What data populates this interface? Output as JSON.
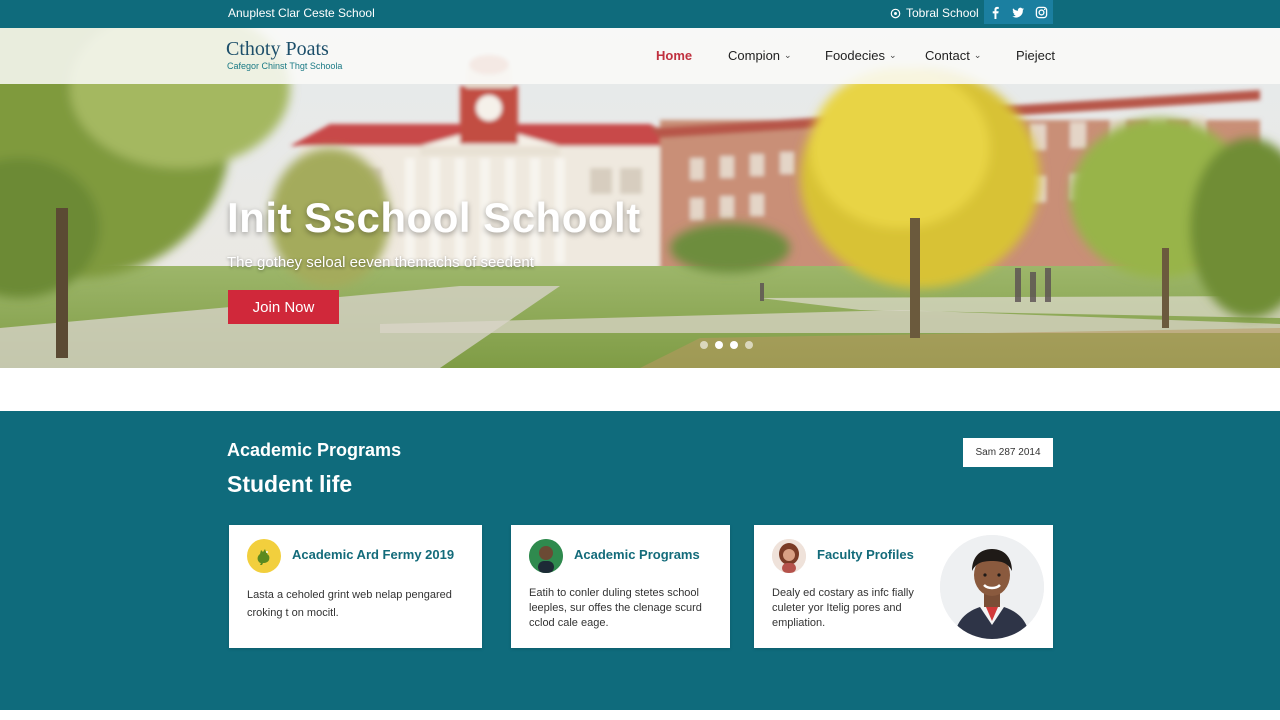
{
  "topbar": {
    "tagline": "Anuplest Clar Ceste School",
    "school_link": "Tobral School",
    "socials": [
      {
        "icon": "facebook-icon",
        "glyph": "f"
      },
      {
        "icon": "twitter-icon",
        "glyph": "t"
      },
      {
        "icon": "instagram-icon",
        "glyph": "i"
      }
    ]
  },
  "header": {
    "logo_title": "Cthoty Poats",
    "logo_subtitle": "Cafegor Chinst Thgt Schoola",
    "nav": [
      {
        "label": "Home",
        "active": true,
        "dropdown": false
      },
      {
        "label": "Compion",
        "active": false,
        "dropdown": true
      },
      {
        "label": "Foodecies",
        "active": false,
        "dropdown": true
      },
      {
        "label": "Contact",
        "active": false,
        "dropdown": true
      },
      {
        "label": "Pieject",
        "active": false,
        "dropdown": false
      }
    ]
  },
  "hero": {
    "title": "Init Sschool Schoolt",
    "subtitle": "The gothey seloal eeven themachs of seedent",
    "cta_label": "Join Now",
    "slides_total": 4,
    "active_slide": 2
  },
  "section": {
    "title": "Academic Programs",
    "subtitle": "Student life",
    "date_label": "Sam 287 2014",
    "cards": [
      {
        "title": "Academic Ard Fermy 2019",
        "body": [
          "Lasta a ceholed grint web nelap pengared",
          "croking t on mocitl."
        ],
        "icon": "rooster-icon"
      },
      {
        "title": "Academic Programs",
        "body": [
          "Eatih to conler duling stetes school",
          "leeples, sur offes the clenage scurd",
          "cclod cale eage."
        ],
        "icon": "student-avatar-icon"
      },
      {
        "title": "Faculty Profiles",
        "body": [
          "Dealy ed costary as infc fially",
          "culeter yor Itelig pores and",
          "empliation."
        ],
        "icon": "faculty-avatar-icon"
      }
    ]
  },
  "colors": {
    "teal": "#0f6b7c",
    "accent_red": "#d0283a",
    "card_title": "#136b7a"
  }
}
